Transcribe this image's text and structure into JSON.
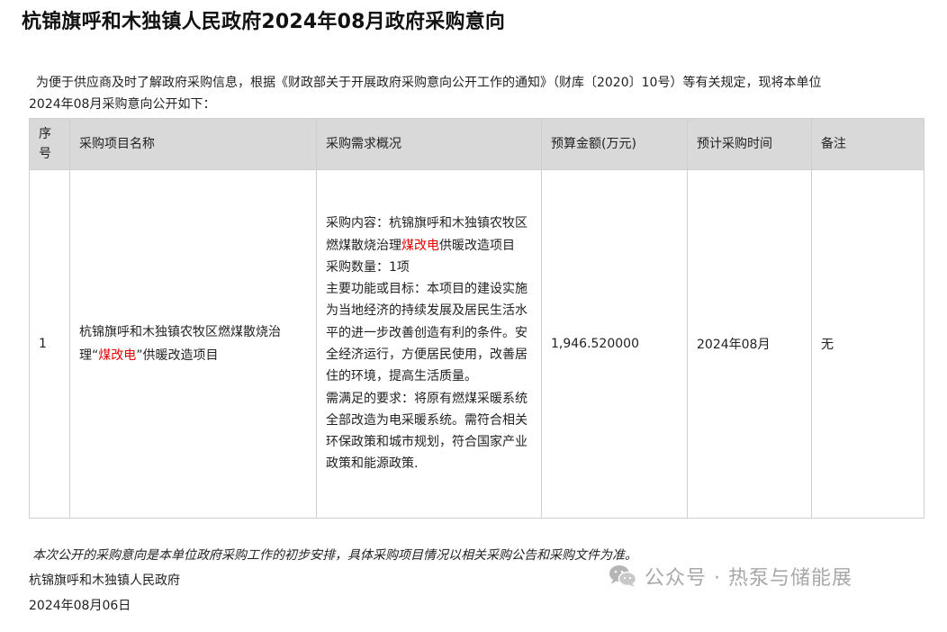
{
  "title": "杭锦旗呼和木独镇人民政府2024年08月政府采购意向",
  "intro": {
    "line1": "为便于供应商及时了解政府采购信息，根据《财政部关于开展政府采购意向公开工作的通知》（财库〔2020〕10号）等有关规定，现将本单位",
    "line2": "2024年08月采购意向公开如下："
  },
  "table": {
    "headers": {
      "seq_1": "序",
      "seq_2": "号",
      "name": "采购项目名称",
      "requirement": "采购需求概况",
      "budget": "预算金额(万元)",
      "time": "预计采购时间",
      "remark": "备注"
    },
    "rows": [
      {
        "seq": "1",
        "name_part1": "杭锦旗呼和木独镇农牧区燃煤散烧治理“",
        "name_highlight": "煤改电",
        "name_part2": "”供暖改造项目",
        "req": {
          "content_prefix": "采购内容：杭锦旗呼和木独镇农牧区燃煤散烧治理",
          "content_highlight": "煤改电",
          "content_suffix": "供暖改造项目",
          "quantity": "采购数量：1项",
          "goal": "主要功能或目标：本项目的建设实施为当地经济的持续发展及居民生活水平的进一步改善创造有利的条件。安全经济运行，方便居民使用，改善居住的环境，提高生活质量。",
          "demand": "需满足的要求：将原有燃煤采暖系统全部改造为电采暖系统。需符合相关环保政策和城市规划，符合国家产业政策和能源政策."
        },
        "budget": "1,946.520000",
        "time": "2024年08月",
        "remark": "无"
      }
    ]
  },
  "footer": {
    "note": "本次公开的采购意向是本单位政府采购工作的初步安排，具体采购项目情况以相关采购公告和采购文件为准。",
    "org": "杭锦旗呼和木独镇人民政府",
    "date": "2024年08月06日"
  },
  "watermark": {
    "icon": "wechat-icon",
    "text": "公众号 · 热泵与储能展"
  },
  "colors": {
    "highlight": "#e60000",
    "header_bg": "#d9d9d9",
    "border": "#cfcfcf",
    "watermark": "#a8a8a8"
  }
}
